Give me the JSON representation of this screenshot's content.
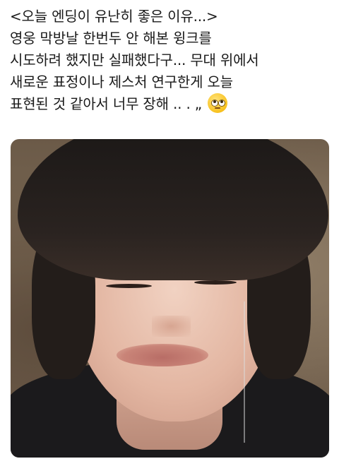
{
  "tweet": {
    "lines": [
      "<오늘 엔딩이 유난히 좋은 이유...>",
      "영웅 막방날 한번두 안 해본 윙크를",
      "시도하려 했지만 실패했다구... 무대 위에서",
      "새로운 표정이나 제스처 연구한게 오늘",
      "표현된 것 같아서 너무 장해 ..   . „"
    ],
    "emoji": "face-with-rolling-eyes-icon"
  },
  "media": {
    "type": "photo",
    "alt": ""
  },
  "colors": {
    "background": "#ffffff",
    "text": "#1a1a1a"
  }
}
